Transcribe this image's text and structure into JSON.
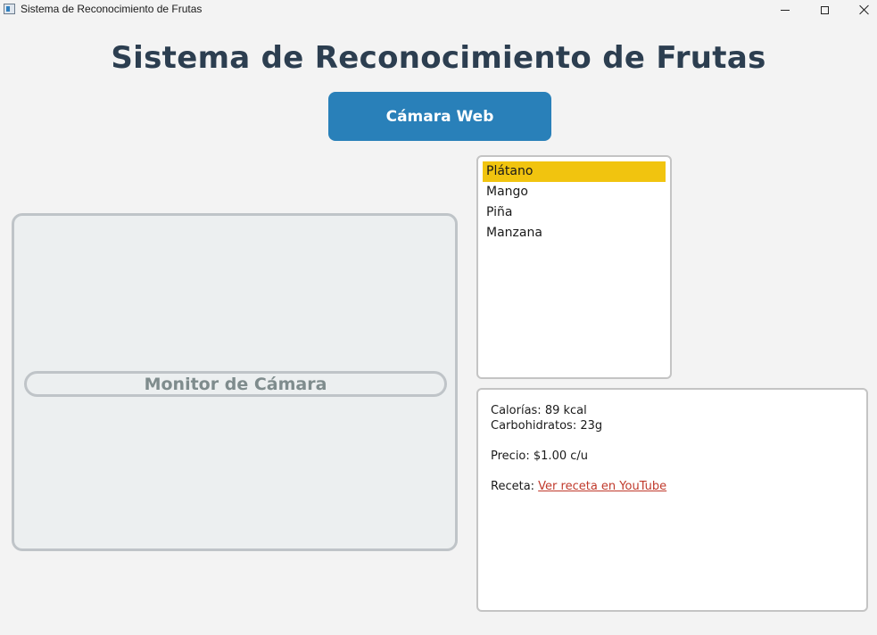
{
  "window": {
    "title": "Sistema de Reconocimiento de Frutas"
  },
  "header": {
    "title": "Sistema de Reconocimiento de Frutas"
  },
  "toolbar": {
    "webcam_label": "Cámara Web"
  },
  "monitor": {
    "label": "Monitor de Cámara"
  },
  "fruits": {
    "items": [
      "Plátano",
      "Mango",
      "Piña",
      "Manzana"
    ],
    "selected": "Plátano"
  },
  "info": {
    "calories": "Calorías: 89 kcal",
    "carbs": "Carbohidratos: 23g",
    "price": "Precio: $1.00 c/u",
    "recipe_label": "Receta: ",
    "recipe_link": "Ver receta en YouTube"
  },
  "colors": {
    "accent": "#2980b9",
    "selection": "#f1c40f",
    "title_text": "#2c3e50",
    "link": "#c0392b"
  }
}
